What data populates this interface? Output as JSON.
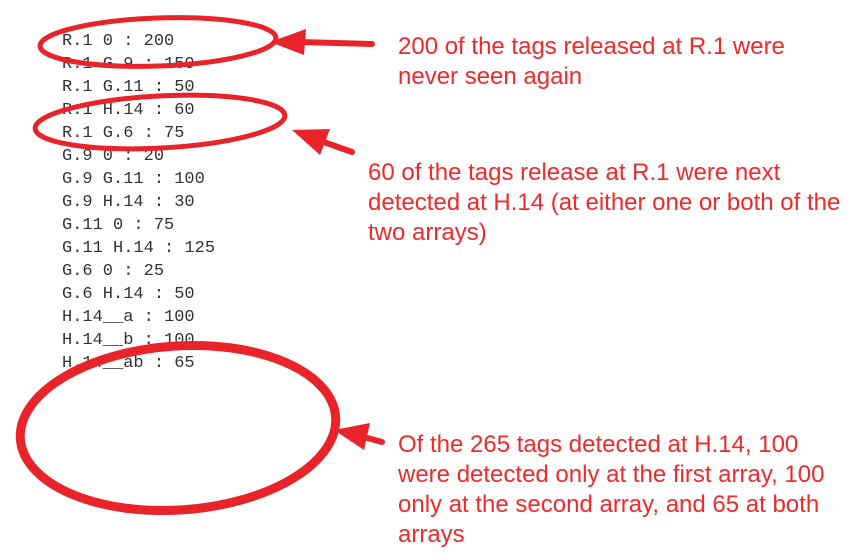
{
  "listing": {
    "lines": [
      "R.1 0 : 200",
      "R.1 G.9 : 150",
      "R.1 G.11 : 50",
      "R.1 H.14 : 60",
      "R.1 G.6 : 75",
      "G.9 0 : 20",
      "G.9 G.11 : 100",
      "G.9 H.14 : 30",
      "G.11 0 : 75",
      "G.11 H.14 : 125",
      "G.6 0 : 25",
      "G.6 H.14 : 50",
      "H.14__a : 100",
      "H.14__b : 100",
      "H.14__ab : 65"
    ]
  },
  "annotations": {
    "note1": "200 of the tags released at R.1 were never seen again",
    "note2": "60 of the tags release at R.1 were next detected at H.14 (at either one or both of the two arrays)",
    "note3": "Of the 265 tags detected at H.14, 100 were detected only at the first array, 100 only at the second array, and 65 at both arrays"
  },
  "colors": {
    "highlight": "#e8242a",
    "text": "#333333",
    "annotation": "#f02a2a"
  }
}
